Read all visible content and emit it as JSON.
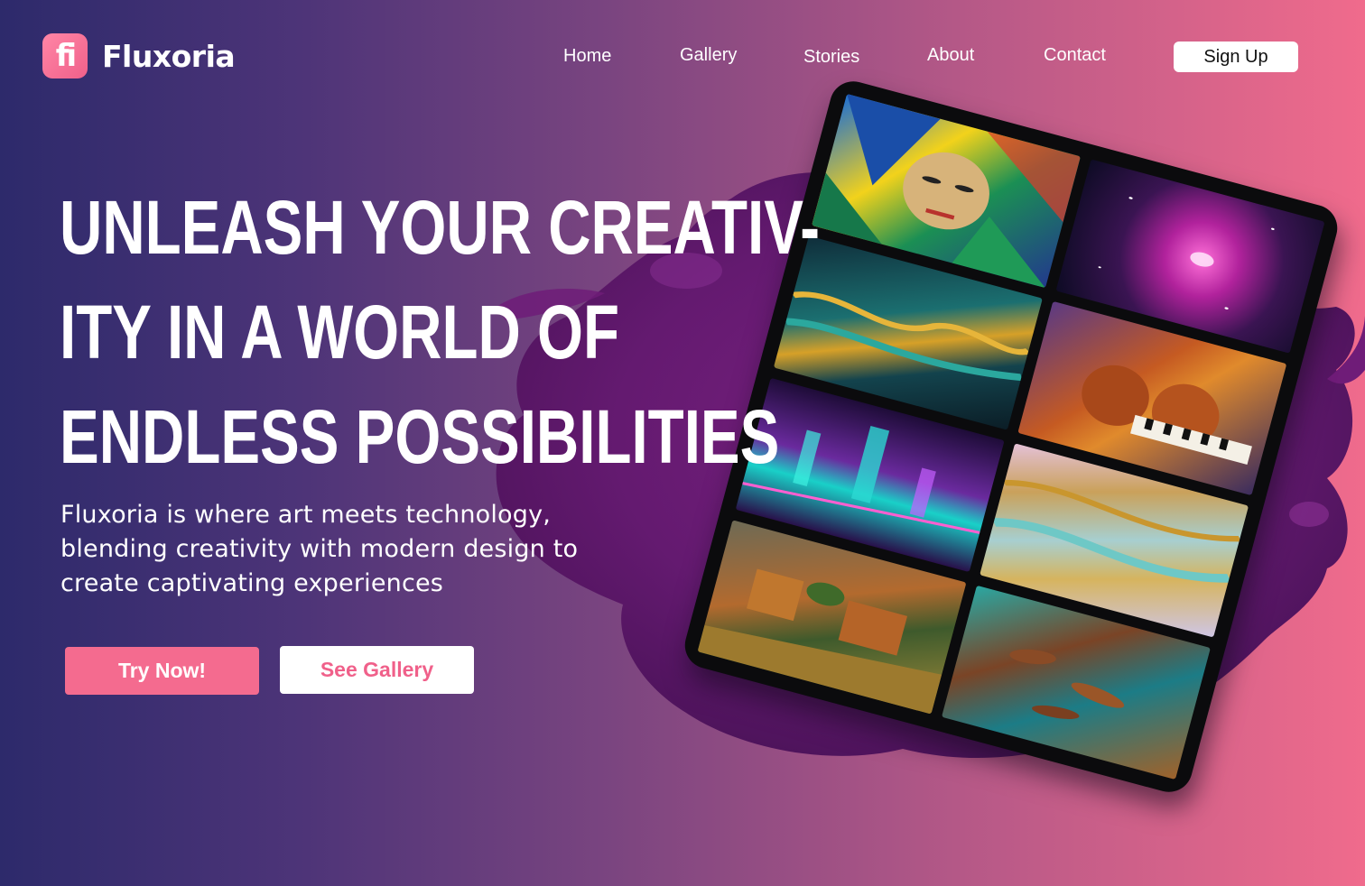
{
  "brand": {
    "logo_glyph": "fi",
    "name": "Fluxoria",
    "accent": "#f46b8f"
  },
  "nav": {
    "items": [
      {
        "label": "Home"
      },
      {
        "label": "Gallery"
      },
      {
        "label": "Stories"
      },
      {
        "label": "About"
      },
      {
        "label": "Contact"
      }
    ],
    "signup_label": "Sign Up"
  },
  "hero": {
    "headline_lines": [
      "UNLEASH YOUR CREATIV-",
      "ITY IN A WORLD OF",
      "ENDLESS POSSIBILITIES"
    ],
    "subtitle_lines": [
      "Fluxoria is where art meets technology,",
      "blending creativity with modern design to",
      "create captivating experiences"
    ],
    "primary_cta": "Try Now!",
    "secondary_cta": "See Gallery"
  },
  "colors": {
    "gradient_start": "#2d2a6b",
    "gradient_end": "#f06b8c",
    "splash": "#6a1a72"
  }
}
